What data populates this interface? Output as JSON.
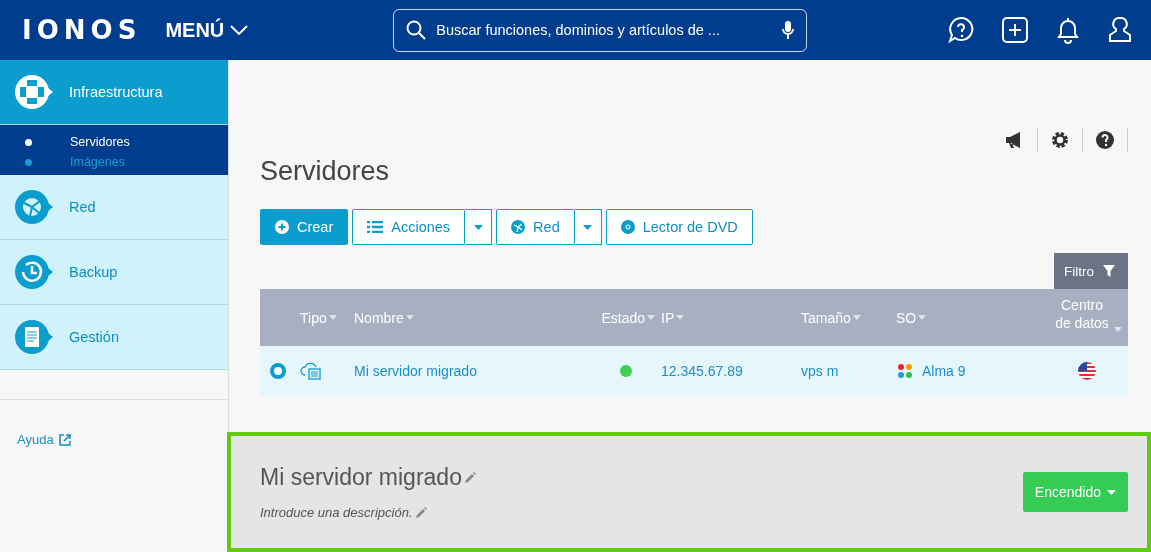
{
  "header": {
    "logo": "IONOS",
    "menu": "MENÚ",
    "search": {
      "placeholder": "Buscar funciones, dominios y artículos de ..."
    }
  },
  "sidebar": {
    "items": [
      {
        "label": "Infraestructura",
        "kind": "infra",
        "selected": true,
        "children": [
          {
            "label": "Servidores",
            "selected": true
          },
          {
            "label": "Imágenes",
            "selected": false
          }
        ]
      },
      {
        "label": "Red",
        "kind": "network",
        "selected": false
      },
      {
        "label": "Backup",
        "kind": "backup",
        "selected": false
      },
      {
        "label": "Gestión",
        "kind": "manage",
        "selected": false
      }
    ],
    "help": "Ayuda"
  },
  "page": {
    "title": "Servidores",
    "toolbar": [
      {
        "label": "Crear",
        "kind": "primary"
      },
      {
        "label": "Acciones",
        "kind": "split"
      },
      {
        "label": "Red",
        "kind": "split"
      },
      {
        "label": "Lector de DVD",
        "kind": "plain"
      }
    ],
    "filter": "Filtro"
  },
  "table": {
    "columns": [
      "Tipo",
      "Nombre",
      "Estado",
      "IP",
      "Tamaño",
      "SO",
      "Centro de datos"
    ],
    "rows": [
      {
        "selected": true,
        "name": "Mi servidor migrado",
        "color": "#3ecf55",
        "ip": "12.345.67.89",
        "size": "vps m",
        "os": "Alma 9"
      }
    ]
  },
  "detail": {
    "name": "Mi servidor migrado",
    "description_placeholder": "Introduce una descripción.",
    "power": "Encendido"
  }
}
